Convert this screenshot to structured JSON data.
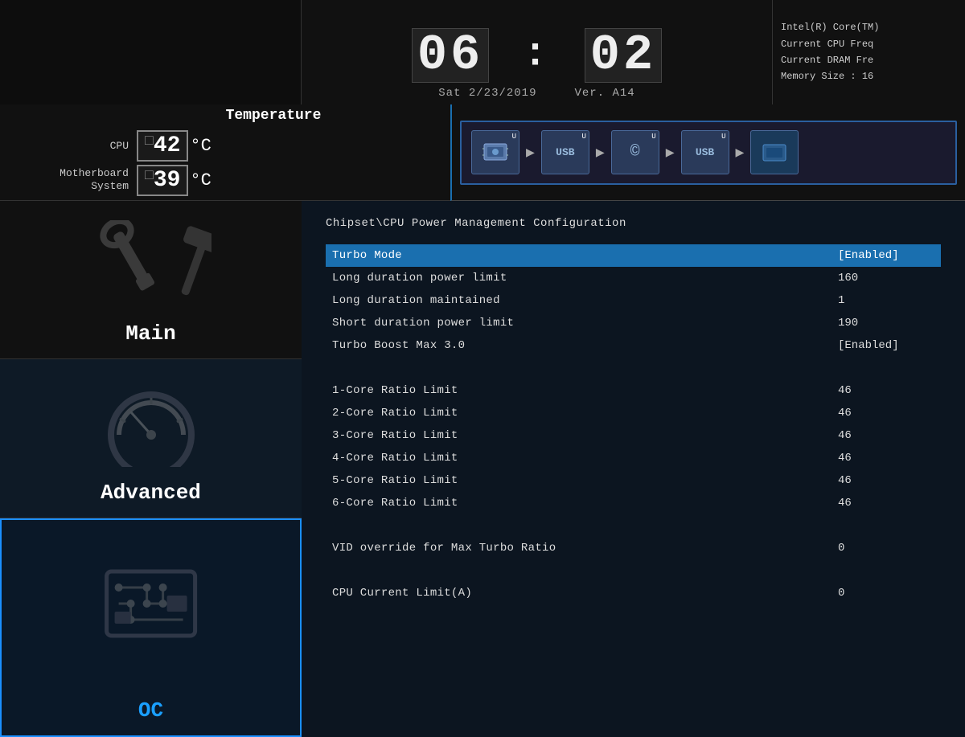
{
  "header": {
    "clock": "06:02",
    "clock_h": "06",
    "clock_m": "02",
    "date": "Sat  2/23/2019",
    "version": "Ver. A14",
    "info_lines": [
      "Intel(R) Core(TM)",
      "Current CPU Freq",
      "Current DRAM Fre",
      "Memory Size : 16"
    ]
  },
  "temperature": {
    "title": "Temperature",
    "cpu_label": "CPU",
    "cpu_value": "42",
    "cpu_unit": "°C",
    "mb_label": "Motherboard\nSystem",
    "mb_value": "39",
    "mb_unit": "°C"
  },
  "nav": {
    "items": [
      {
        "id": "main",
        "label": "Main",
        "active": false
      },
      {
        "id": "advanced",
        "label": "Advanced",
        "active": false
      },
      {
        "id": "oc",
        "label": "OC",
        "active": true
      }
    ]
  },
  "content": {
    "breadcrumb": "Chipset\\CPU Power Management Configuration",
    "settings": [
      {
        "name": "Turbo Mode",
        "value": "[Enabled]",
        "highlighted": true
      },
      {
        "name": "Long duration power limit",
        "value": "160",
        "highlighted": false
      },
      {
        "name": "Long duration maintained",
        "value": "1",
        "highlighted": false
      },
      {
        "name": "Short duration power limit",
        "value": "190",
        "highlighted": false
      },
      {
        "name": "Turbo Boost Max 3.0",
        "value": "[Enabled]",
        "highlighted": false
      },
      {
        "spacer": true
      },
      {
        "name": "1-Core Ratio Limit",
        "value": "46",
        "highlighted": false
      },
      {
        "name": "2-Core Ratio Limit",
        "value": "46",
        "highlighted": false
      },
      {
        "name": "3-Core Ratio Limit",
        "value": "46",
        "highlighted": false
      },
      {
        "name": "4-Core Ratio Limit",
        "value": "46",
        "highlighted": false
      },
      {
        "name": "5-Core Ratio Limit",
        "value": "46",
        "highlighted": false
      },
      {
        "name": "6-Core Ratio Limit",
        "value": "46",
        "highlighted": false
      },
      {
        "spacer": true
      },
      {
        "name": "VID override for Max Turbo Ratio",
        "value": "0",
        "highlighted": false
      },
      {
        "spacer": true
      },
      {
        "name": "CPU Current Limit(A)",
        "value": "0",
        "highlighted": false
      }
    ]
  },
  "icons": {
    "usb_chips": [
      {
        "label": "U",
        "icon": "💾",
        "text": ""
      },
      {
        "label": "U",
        "icon": "USB",
        "text": ""
      },
      {
        "label": "U",
        "icon": "©",
        "text": ""
      },
      {
        "label": "U",
        "icon": "USB",
        "text": ""
      }
    ]
  }
}
